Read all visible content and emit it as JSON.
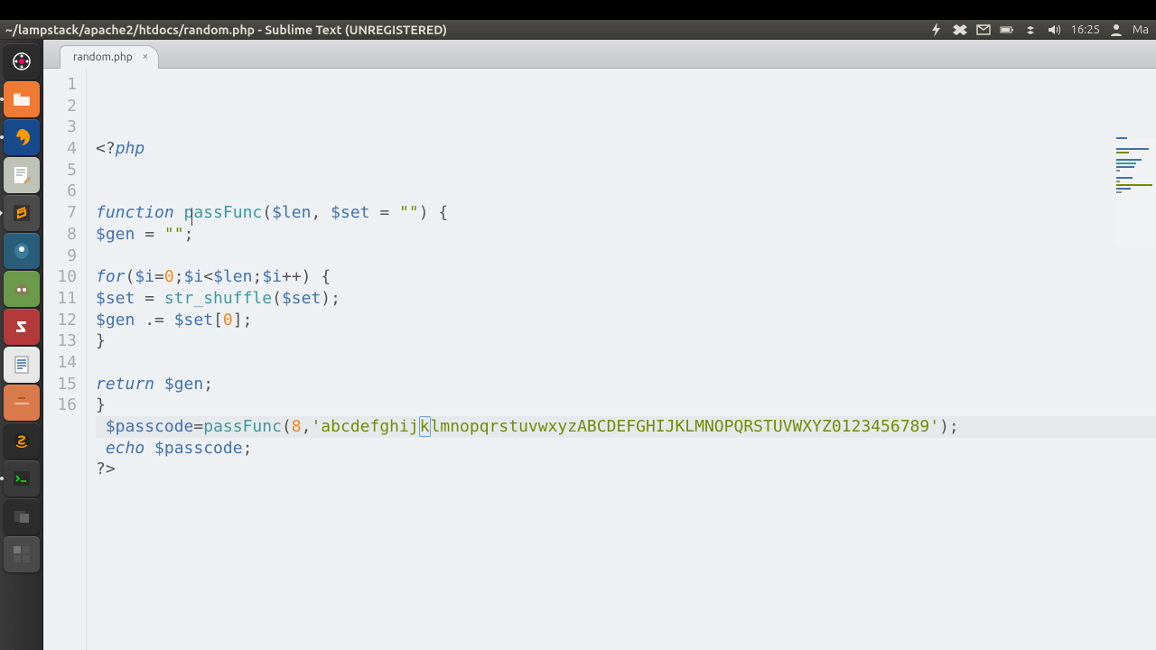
{
  "window": {
    "title": "~/lampstack/apache2/htdocs/random.php - Sublime Text (UNREGISTERED)"
  },
  "systray": {
    "time": "16:25",
    "user_label": "Ma"
  },
  "launcher": {
    "items": [
      {
        "name": "dash",
        "bg": "#2c2c2c"
      },
      {
        "name": "files",
        "bg": "#f07933"
      },
      {
        "name": "firefox",
        "bg": "#174a8c"
      },
      {
        "name": "gedit",
        "bg": "#bfc2b7"
      },
      {
        "name": "sublime",
        "bg": "#4a4a4a",
        "active": true
      },
      {
        "name": "shotwell",
        "bg": "#2a5d7a"
      },
      {
        "name": "gimp",
        "bg": "#6a9a4a"
      },
      {
        "name": "filezilla",
        "bg": "#b23a3a"
      },
      {
        "name": "libreoffice",
        "bg": "#e8e8e8"
      },
      {
        "name": "software",
        "bg": "#d87a4a"
      },
      {
        "name": "amazon",
        "bg": "#2c2c2c"
      },
      {
        "name": "terminal",
        "bg": "#3a3a3a"
      },
      {
        "name": "devices",
        "bg": "#2c2c2c"
      },
      {
        "name": "workspace",
        "bg": "#4a4a4a"
      }
    ]
  },
  "tabs": {
    "active": {
      "label": "random.php"
    }
  },
  "code": {
    "lines": [
      {
        "n": 1,
        "tokens": [
          [
            "punc",
            "<?"
          ],
          [
            "kw",
            "php"
          ]
        ]
      },
      {
        "n": 2,
        "tokens": []
      },
      {
        "n": 3,
        "tokens": []
      },
      {
        "n": 4,
        "tokens": [
          [
            "kw",
            "function "
          ],
          [
            "fn",
            "passFunc"
          ],
          [
            "punc",
            "("
          ],
          [
            "var",
            "$len"
          ],
          [
            "punc",
            ", "
          ],
          [
            "var",
            "$set"
          ],
          [
            "punc",
            " = "
          ],
          [
            "str",
            "\"\""
          ],
          [
            "punc",
            ") {"
          ]
        ]
      },
      {
        "n": 5,
        "tokens": [
          [
            "var",
            "$gen"
          ],
          [
            "punc",
            " = "
          ],
          [
            "str",
            "\"\""
          ],
          [
            "punc",
            ";"
          ]
        ]
      },
      {
        "n": 6,
        "tokens": []
      },
      {
        "n": 7,
        "tokens": [
          [
            "kw",
            "for"
          ],
          [
            "punc",
            "("
          ],
          [
            "var",
            "$i"
          ],
          [
            "punc",
            "="
          ],
          [
            "num",
            "0"
          ],
          [
            "punc",
            ";"
          ],
          [
            "var",
            "$i"
          ],
          [
            "punc",
            "<"
          ],
          [
            "var",
            "$len"
          ],
          [
            "punc",
            ";"
          ],
          [
            "var",
            "$i"
          ],
          [
            "punc",
            "++) {"
          ]
        ]
      },
      {
        "n": 8,
        "tokens": [
          [
            "var",
            "$set"
          ],
          [
            "punc",
            " = "
          ],
          [
            "fn",
            "str_shuffle"
          ],
          [
            "punc",
            "("
          ],
          [
            "var",
            "$set"
          ],
          [
            "punc",
            ");"
          ]
        ]
      },
      {
        "n": 9,
        "tokens": [
          [
            "var",
            "$gen"
          ],
          [
            "punc",
            " .= "
          ],
          [
            "var",
            "$set"
          ],
          [
            "punc",
            "["
          ],
          [
            "num",
            "0"
          ],
          [
            "punc",
            "];"
          ]
        ]
      },
      {
        "n": 10,
        "tokens": [
          [
            "punc",
            "}"
          ]
        ]
      },
      {
        "n": 11,
        "tokens": []
      },
      {
        "n": 12,
        "tokens": [
          [
            "kw",
            "return "
          ],
          [
            "var",
            "$gen"
          ],
          [
            "punc",
            ";"
          ]
        ]
      },
      {
        "n": 13,
        "tokens": [
          [
            "punc",
            "}"
          ]
        ]
      },
      {
        "n": 14,
        "hl": true,
        "tokens": [
          [
            "punc",
            " "
          ],
          [
            "var",
            "$passcode"
          ],
          [
            "punc",
            "="
          ],
          [
            "fn",
            "passFunc"
          ],
          [
            "punc",
            "("
          ],
          [
            "num",
            "8"
          ],
          [
            "punc",
            ","
          ],
          [
            "str",
            "'abcdefghij"
          ],
          [
            "sel",
            "k"
          ],
          [
            "str",
            "lmnopqrstuvwxyzABCDEFGHIJKLMNOPQRSTUVWXYZ0123456789'"
          ],
          [
            "punc",
            ");"
          ]
        ]
      },
      {
        "n": 15,
        "tokens": [
          [
            "punc",
            " "
          ],
          [
            "kw",
            "echo "
          ],
          [
            "var",
            "$passcode"
          ],
          [
            "punc",
            ";"
          ]
        ]
      },
      {
        "n": 16,
        "tokens": [
          [
            "punc",
            "?>"
          ]
        ]
      }
    ]
  },
  "minimap": {
    "rows": [
      {
        "w": 12,
        "c": "#4271ae"
      },
      {
        "w": 0,
        "c": "#888"
      },
      {
        "w": 0,
        "c": "#888"
      },
      {
        "w": 36,
        "c": "#4271ae"
      },
      {
        "w": 14,
        "c": "#718c00"
      },
      {
        "w": 0,
        "c": "#888"
      },
      {
        "w": 28,
        "c": "#4271ae"
      },
      {
        "w": 22,
        "c": "#3e999f"
      },
      {
        "w": 20,
        "c": "#4271ae"
      },
      {
        "w": 4,
        "c": "#888"
      },
      {
        "w": 0,
        "c": "#888"
      },
      {
        "w": 18,
        "c": "#4271ae"
      },
      {
        "w": 4,
        "c": "#888"
      },
      {
        "w": 40,
        "c": "#718c00"
      },
      {
        "w": 16,
        "c": "#4271ae"
      },
      {
        "w": 6,
        "c": "#888"
      }
    ]
  }
}
